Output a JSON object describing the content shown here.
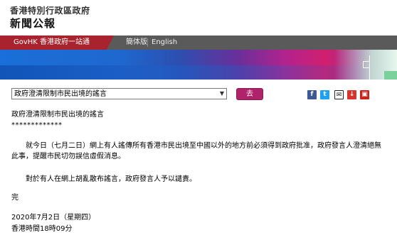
{
  "header": {
    "gov_name": "香港特別行政區政府",
    "site_title": "新聞公報"
  },
  "nav": {
    "govhk": "GovHK 香港政府一站通",
    "simplified": "簡体版",
    "english": "English"
  },
  "banner": {
    "colors": [
      "#1a6fd8",
      "#6a2f9a",
      "#d21f6f",
      "#e8f7ee"
    ]
  },
  "toolbar": {
    "selected_article": "政府澄清限制市民出境的謠言",
    "go_label": "去"
  },
  "share": {
    "icons": [
      "facebook-icon",
      "twitter-icon",
      "mail-icon",
      "print-icon",
      "save-icon"
    ],
    "fb_glyph": "f",
    "tw_glyph": "t",
    "mail_glyph": "✉",
    "print_glyph": "↓",
    "save_glyph": "▣"
  },
  "article": {
    "title": "政府澄清限制市民出境的謠言",
    "stars": "*************",
    "paragraph1": "就今日（七月二日）網上有人謠傳所有香港市民出境至中國以外的地方前必須得到政府批准，政府發言人澄清絕無此事，提醒市民切勿誤信虛假消息。",
    "paragraph2": "對於有人在網上胡亂散布謠言，政府發言人予以譴責。",
    "end": "完",
    "date": "2020年7月2日（星期四）",
    "time": "香港時間18時09分"
  }
}
